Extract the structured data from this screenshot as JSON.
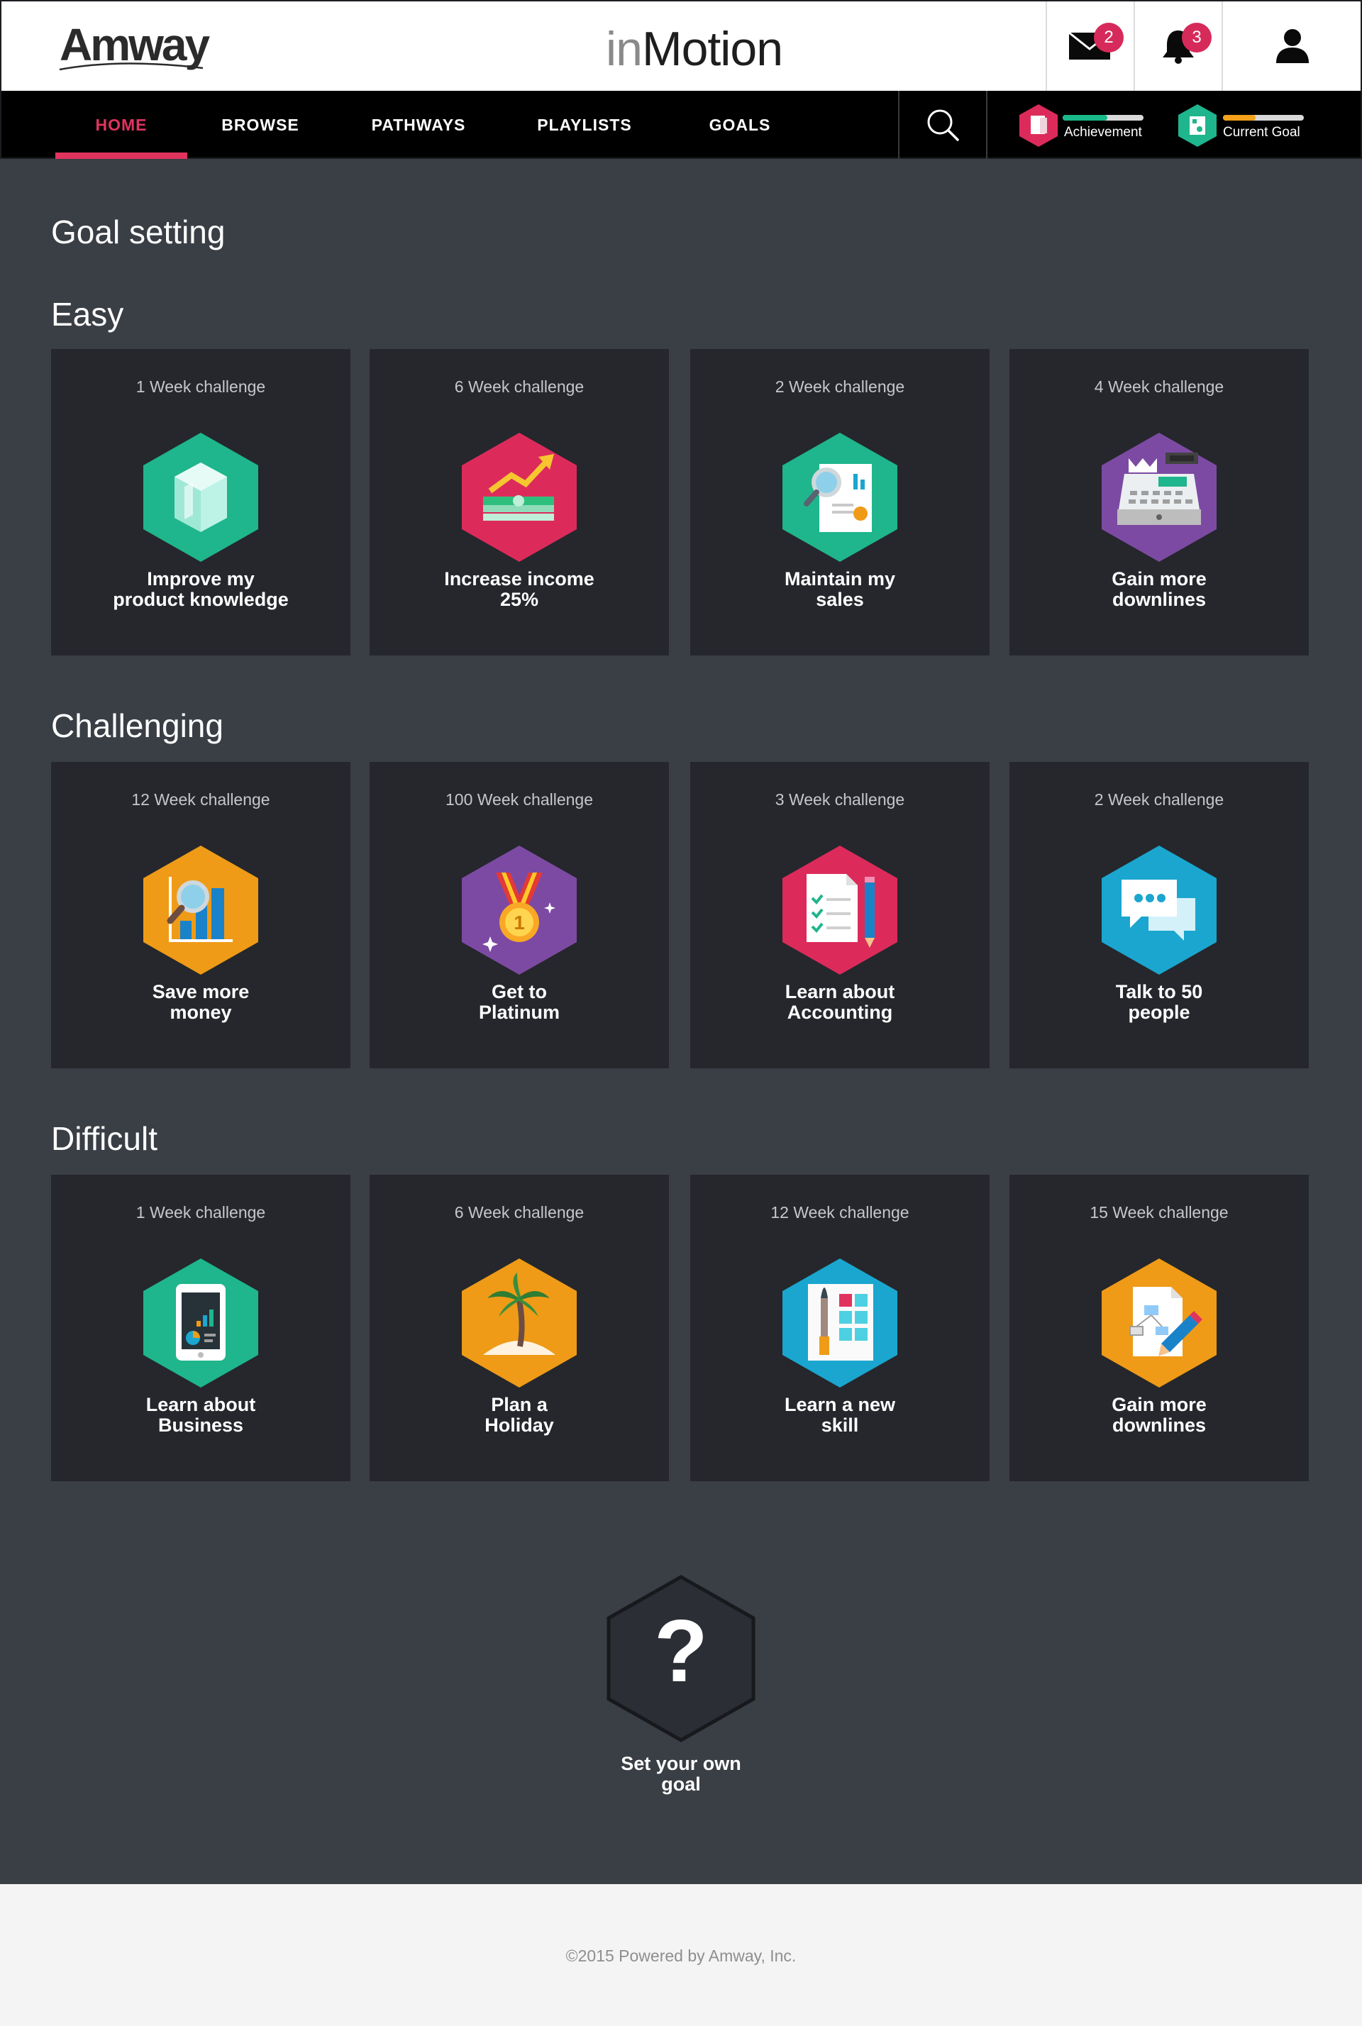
{
  "header": {
    "brand": "Amway",
    "app_title_prefix": "in",
    "app_title_main": "Motion",
    "messages_count": "2",
    "notifications_count": "3"
  },
  "nav": {
    "items": [
      {
        "label": "HOME",
        "active": true
      },
      {
        "label": "BROWSE"
      },
      {
        "label": "PATHWAYS"
      },
      {
        "label": "PLAYLISTS"
      },
      {
        "label": "GOALS"
      }
    ],
    "achievement": {
      "label": "Achievement",
      "progress": 0.55,
      "color": "#19b98a"
    },
    "current_goal": {
      "label": "Current Goal",
      "progress": 0.4,
      "color": "#f5a21a"
    }
  },
  "page_title": "Goal setting",
  "sections": [
    {
      "title": "Easy",
      "cards": [
        {
          "duration": "1 Week challenge",
          "label_1": "Improve my",
          "label_2": "product knowledge",
          "icon": "crystal-icon",
          "color": "#1fb58d"
        },
        {
          "duration": "6 Week challenge",
          "label_1": "Increase income",
          "label_2": "25%",
          "icon": "money-growth-icon",
          "color": "#dc2b5b"
        },
        {
          "duration": "2 Week challenge",
          "label_1": "Maintain my",
          "label_2": "sales",
          "icon": "sales-report-icon",
          "color": "#1fb58d"
        },
        {
          "duration": "4 Week challenge",
          "label_1": "Gain more",
          "label_2": "downlines",
          "icon": "cash-register-icon",
          "color": "#7c4aa3"
        }
      ]
    },
    {
      "title": "Challenging",
      "cards": [
        {
          "duration": "12 Week challenge",
          "label_1": "Save more",
          "label_2": "money",
          "icon": "chart-magnifier-icon",
          "color": "#ef9b17"
        },
        {
          "duration": "100 Week challenge",
          "label_1": "Get to",
          "label_2": "Platinum",
          "icon": "medal-icon",
          "color": "#7c4aa3"
        },
        {
          "duration": "3 Week challenge",
          "label_1": "Learn about",
          "label_2": "Accounting",
          "icon": "checklist-icon",
          "color": "#dc2b5b"
        },
        {
          "duration": "2 Week challenge",
          "label_1": "Talk to 50",
          "label_2": "people",
          "icon": "chat-bubbles-icon",
          "color": "#1aa6cf"
        }
      ]
    },
    {
      "title": "Difficult",
      "cards": [
        {
          "duration": "1 Week challenge",
          "label_1": "Learn about",
          "label_2": "Business",
          "icon": "tablet-chart-icon",
          "color": "#1fb58d"
        },
        {
          "duration": "6 Week challenge",
          "label_1": "Plan a",
          "label_2": "Holiday",
          "icon": "palm-tree-icon",
          "color": "#ef9b17"
        },
        {
          "duration": "12 Week challenge",
          "label_1": "Learn a new",
          "label_2": "skill",
          "icon": "palette-brush-icon",
          "color": "#1aa6cf"
        },
        {
          "duration": "15 Week challenge",
          "label_1": "Gain more",
          "label_2": "downlines",
          "icon": "flowchart-pencil-icon",
          "color": "#ef9b17"
        }
      ]
    }
  ],
  "own_goal": {
    "symbol": "?",
    "label_1": "Set your own",
    "label_2": "goal"
  },
  "footer": {
    "copyright": "©2015 Powered by Amway, Inc."
  }
}
